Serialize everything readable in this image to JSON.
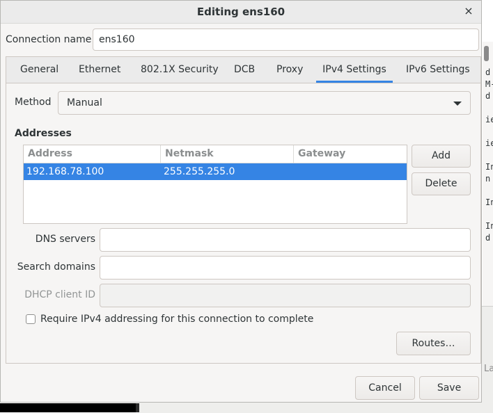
{
  "background": {
    "terminal_fragments": [
      "d",
      "M-",
      "d",
      "",
      "ie",
      "",
      "ie",
      "",
      "In",
      "n a",
      "",
      "In",
      "",
      "In",
      "d"
    ],
    "bottom_fragment": "La"
  },
  "dialog": {
    "title": "Editing ens160",
    "close_glyph": "×",
    "connection_name_label": "Connection name",
    "connection_name_value": "ens160"
  },
  "tabs": [
    {
      "label": "General"
    },
    {
      "label": "Ethernet"
    },
    {
      "label": "802.1X Security"
    },
    {
      "label": "DCB"
    },
    {
      "label": "Proxy"
    },
    {
      "label": "IPv4 Settings",
      "active": true
    },
    {
      "label": "IPv6 Settings"
    }
  ],
  "ipv4": {
    "method_label": "Method",
    "method_value": "Manual",
    "addresses_heading": "Addresses",
    "columns": [
      "Address",
      "Netmask",
      "Gateway"
    ],
    "rows": [
      {
        "address": "192.168.78.100",
        "netmask": "255.255.255.0",
        "gateway": ""
      }
    ],
    "add_label": "Add",
    "delete_label": "Delete",
    "dns_label": "DNS servers",
    "dns_value": "",
    "search_label": "Search domains",
    "search_value": "",
    "dhcp_label": "DHCP client ID",
    "dhcp_value": "",
    "require_label": "Require IPv4 addressing for this connection to complete",
    "require_checked": false,
    "routes_label": "Routes…"
  },
  "footer": {
    "cancel_label": "Cancel",
    "save_label": "Save"
  },
  "colors": {
    "accent": "#3584e4",
    "window_bg": "#f6f5f4"
  }
}
